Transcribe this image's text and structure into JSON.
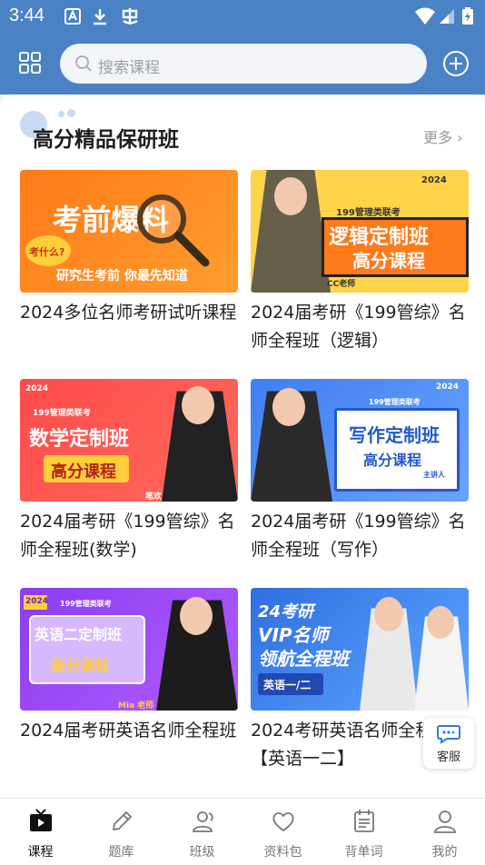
{
  "status_bar": {
    "time": "3:44"
  },
  "search": {
    "placeholder": "搜索课程"
  },
  "section": {
    "title": "高分精品保研班",
    "more_label": "更多 ›"
  },
  "courses": [
    {
      "title": "2024多位名师考研试听课程",
      "thumb": {
        "line1": "考前爆料",
        "line2": "考什么?",
        "line3": "研究生考前 你最先知道"
      }
    },
    {
      "title": "2024届考研《199管综》名师全程班（逻辑）",
      "thumb": {
        "tag": "2024",
        "line1": "199管理类联考",
        "line2": "逻辑定制班",
        "line3": "高分课程",
        "teacher": "CC老师"
      }
    },
    {
      "title": "2024届考研《199管综》名师全程班(数学)",
      "thumb": {
        "tag": "2024",
        "line1": "199管理类联考",
        "line2": "数学定制班",
        "line3": "高分课程",
        "teacher": "笔欢"
      }
    },
    {
      "title": "2024届考研《199管综》名师全程班（写作）",
      "thumb": {
        "tag": "2024",
        "line1": "199管理类联考",
        "line2": "写作定制班",
        "line3": "高分课程",
        "teacher": "主讲人"
      }
    },
    {
      "title": "2024届考研英语名师全程班",
      "thumb": {
        "tag": "2024",
        "line1": "199管理类联考",
        "line2": "英语二定制班",
        "line3": "高分课程",
        "teacher": "Mia 老师"
      }
    },
    {
      "title": "2024考研英语名师全程班【英语一二】",
      "thumb": {
        "line1": "24考研",
        "line2": "VIP名师",
        "line3": "领航全程班",
        "tag": "英语一/二"
      }
    }
  ],
  "float_button": {
    "label": "客服"
  },
  "tabs": [
    {
      "label": "课程",
      "icon": "play-icon",
      "active": true
    },
    {
      "label": "题库",
      "icon": "pencil-icon",
      "active": false
    },
    {
      "label": "班级",
      "icon": "people-icon",
      "active": false
    },
    {
      "label": "资料包",
      "icon": "heart-icon",
      "active": false
    },
    {
      "label": "背单词",
      "icon": "calendar-icon",
      "active": false
    },
    {
      "label": "我的",
      "icon": "user-icon",
      "active": false
    }
  ],
  "colors": {
    "header": "#4a82c5",
    "accent": "#111111"
  }
}
